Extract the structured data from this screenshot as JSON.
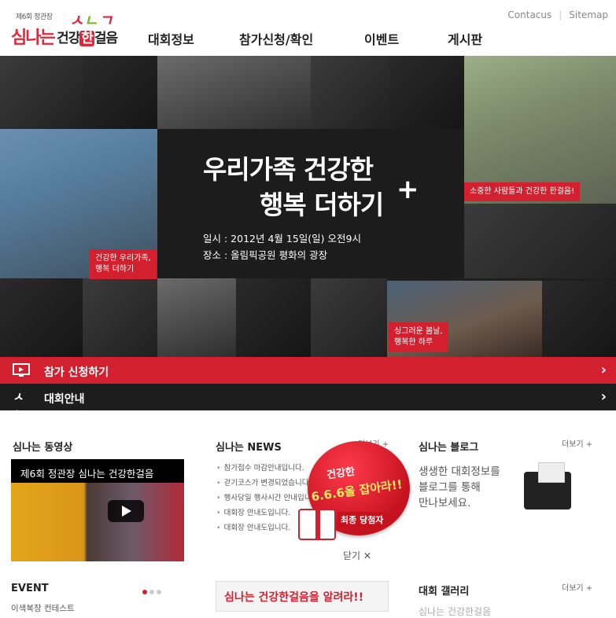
{
  "header": {
    "logo": {
      "small": "제6회 정관장",
      "main": "심나는",
      "sub_before": "건강",
      "sub_han": "한",
      "sub_after": "걸음"
    },
    "nav": [
      "대회정보",
      "참가신청/확인",
      "이벤트",
      "게시판"
    ],
    "top_links": [
      "Contacus",
      "Sitemap"
    ]
  },
  "visual": {
    "headline_line1": "우리가족 건강한",
    "headline_line2": "행복 더하기",
    "headline_plus": "+",
    "date": "일시 : 2012년 4월 15일(일) 오전9시",
    "place": "장소 : 올림픽공원 평화의 광장",
    "caption_left": "건강한 우리가족,\n행복 더하기",
    "caption_right": "소중한 사람들과 건강한 한걸음!",
    "caption_bottom": "싱그러운 봄날,\n행복한 하루"
  },
  "bars": {
    "apply": "참가 신청하기",
    "info": "대회안내"
  },
  "sections": {
    "video": {
      "title": "심나는 동영상",
      "video_title": "제6회 정관장 심나는 건강한걸음"
    },
    "news": {
      "title": "심나는 NEWS",
      "more": "더보기 +",
      "items": [
        "참가접수 마감안내입니다.",
        "걷기코스가 변경되었습니다",
        "행사당일 행사시간 안내입니",
        "대회장 안내도입니다.",
        "대회장 안내도입니다."
      ]
    },
    "popup": {
      "line1": "건강한",
      "line2": "6.6.6을 잡아라!!",
      "line3": "최종 당첨자",
      "close": "닫기 ✕"
    },
    "blog": {
      "title": "심나는 블로그",
      "more": "더보기 +",
      "text": "생생한 대회정보를\n블로그를 통해\n만나보세요."
    },
    "event": {
      "title": "EVENT",
      "sub": "이색복장 컨테스트"
    },
    "banner": {
      "text": "심나는 건강한걸음을 알려라!!"
    },
    "gallery": {
      "title": "대회 갤러리",
      "more": "더보기 +",
      "sub": "심나는 건강한걸음"
    }
  },
  "colors": {
    "brand_red": "#d3202f",
    "dark_bar": "#1d1d1d",
    "accent_green": "#7bb620"
  }
}
